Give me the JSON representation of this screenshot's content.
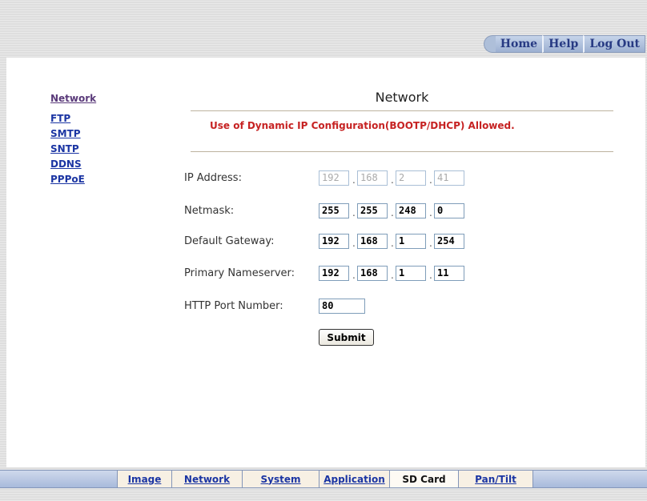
{
  "top_nav": {
    "home": "Home",
    "help": "Help",
    "logout": "Log Out"
  },
  "sidebar": {
    "items": [
      "Network",
      "FTP",
      "SMTP",
      "SNTP",
      "DDNS",
      "PPPoE"
    ]
  },
  "main": {
    "title": "Network",
    "notice": "Use of Dynamic IP Configuration(BOOTP/DHCP) Allowed.",
    "notice_color": "#c62222",
    "fields": {
      "ip_address": {
        "label": "IP Address:",
        "octets": [
          "192",
          "168",
          "2",
          "41"
        ],
        "disabled": true
      },
      "netmask": {
        "label": "Netmask:",
        "octets": [
          "255",
          "255",
          "248",
          "0"
        ]
      },
      "gateway": {
        "label": "Default Gateway:",
        "octets": [
          "192",
          "168",
          "1",
          "254"
        ]
      },
      "nameserver": {
        "label": "Primary Nameserver:",
        "octets": [
          "192",
          "168",
          "1",
          "11"
        ]
      },
      "http_port": {
        "label": "HTTP Port Number:",
        "value": "80"
      }
    },
    "submit_label": "Submit",
    "dot": "."
  },
  "bottom_nav": {
    "tabs": [
      "Image",
      "Network",
      "System",
      "Application",
      "SD Card",
      "Pan/Tilt"
    ],
    "selected": "SD Card"
  }
}
